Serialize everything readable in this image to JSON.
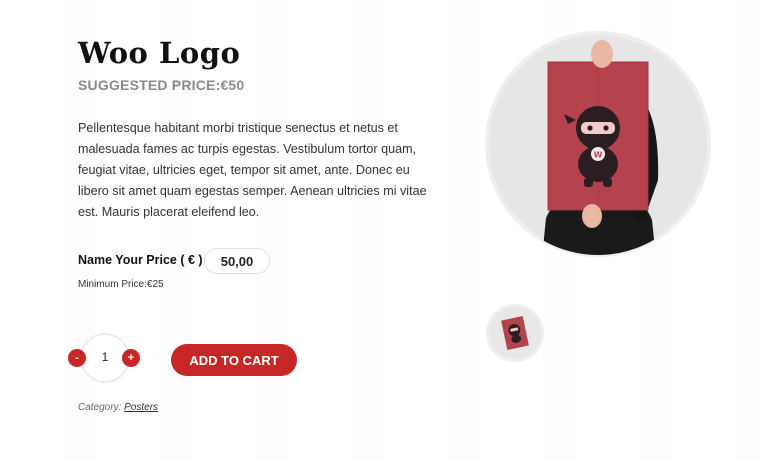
{
  "product": {
    "title": "Woo Logo",
    "suggested_price": "SUGGESTED PRICE:€50",
    "description": "Pellentesque habitant morbi tristique senectus et netus et malesuada fames ac turpis egestas. Vestibulum tortor quam, feugiat vitae, ultricies eget, tempor sit amet, ante. Donec eu libero sit amet quam egestas semper. Aenean ultricies mi vitae est. Mauris placerat eleifend leo.",
    "name_your_price_label": "Name Your Price ( € )",
    "price_value": "50,00",
    "minimum_price": "Minimum Price:€25",
    "category_label": "Category:",
    "category_link": "Posters",
    "poster_letter": "W"
  },
  "cart": {
    "quantity": "1",
    "minus_label": "-",
    "plus_label": "+",
    "add_to_cart_label": "ADD TO CART"
  },
  "colors": {
    "accent": "#c62828",
    "poster": "#b5434d",
    "text": "#222222",
    "muted": "#8a8a8a"
  },
  "icons": {
    "main_image": "ninja-poster-image",
    "thumbnail": "ninja-poster-thumbnail"
  }
}
